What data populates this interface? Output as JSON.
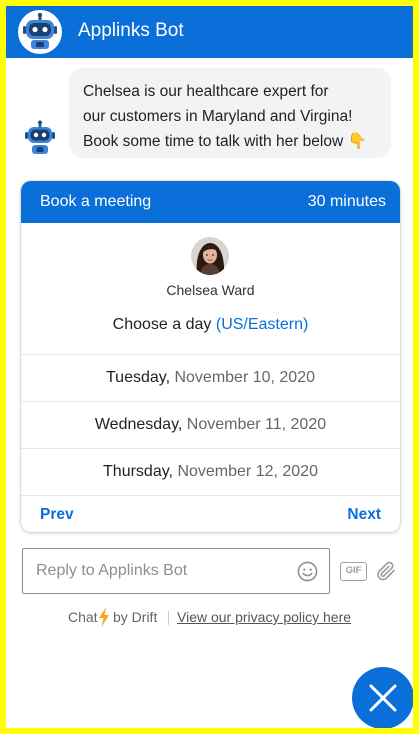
{
  "header": {
    "title": "Applinks Bot",
    "avatar_icon": "robot-icon"
  },
  "message": {
    "avatar_icon": "robot-icon",
    "line1": "Chelsea is our healthcare expert for",
    "line2": "our customers in Maryland and Virgina!",
    "line3": "Book some time to talk with her below",
    "emoji": "👇"
  },
  "meeting": {
    "title": "Book a meeting",
    "duration": "30 minutes",
    "agent_name": "Chelsea Ward",
    "choose_label": "Choose a day",
    "timezone": "(US/Eastern)",
    "days": [
      {
        "weekday": "Tuesday,",
        "date": "November 10, 2020"
      },
      {
        "weekday": "Wednesday,",
        "date": "November 11, 2020"
      },
      {
        "weekday": "Thursday,",
        "date": "November 12, 2020"
      }
    ],
    "prev_label": "Prev",
    "next_label": "Next"
  },
  "composer": {
    "placeholder": "Reply to Applinks Bot",
    "gif_label": "GIF"
  },
  "footer": {
    "chat_label": "Chat",
    "by_label": "by Drift",
    "privacy_label": "View our privacy policy here"
  },
  "colors": {
    "accent": "#0a6fd9",
    "outer_border": "#ffff00"
  }
}
